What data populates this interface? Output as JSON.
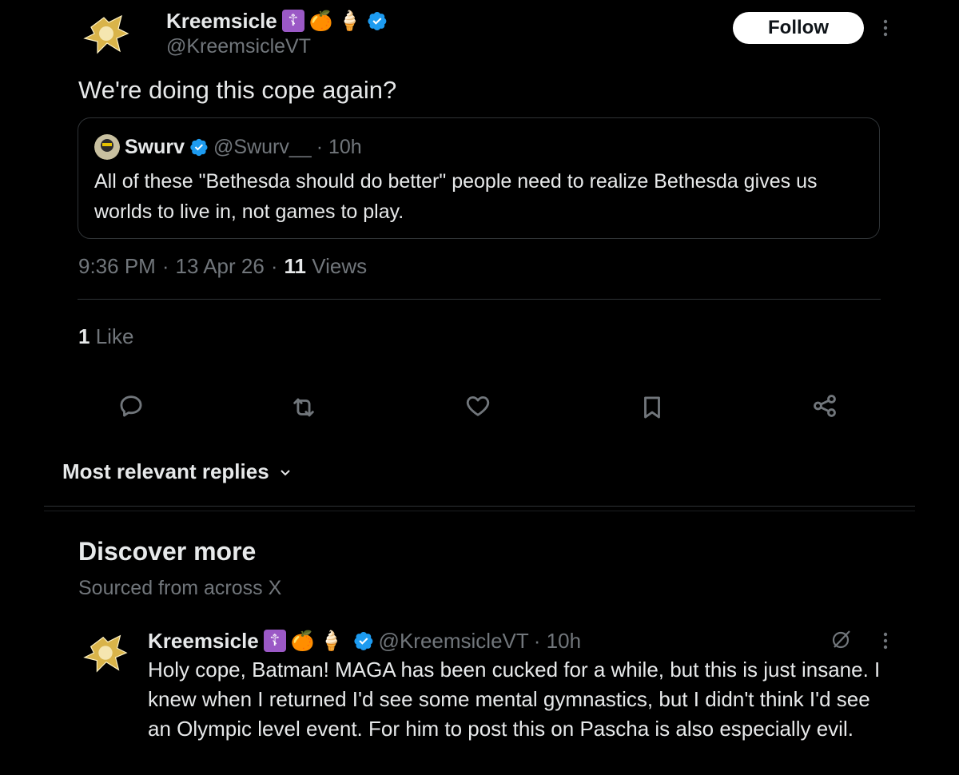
{
  "author": {
    "name": "Kreemsicle",
    "handle": "@KreemsicleVT",
    "emojis": [
      "☦",
      "🍊",
      "🍦"
    ]
  },
  "follow_label": "Follow",
  "post": {
    "text": "We're doing this cope again?"
  },
  "quote": {
    "name": "Swurv",
    "handle": "@Swurv__",
    "time": "· 10h",
    "text": "All of these \"Bethesda should do better\" people need to realize Bethesda gives us worlds to live in, not games to play."
  },
  "meta": {
    "time": "9:36 PM",
    "sep1": "·",
    "date": "13 Apr 26",
    "sep2": "·",
    "views_count": "11",
    "views_label": "Views"
  },
  "likes": {
    "count": "1",
    "label": "Like"
  },
  "actions": [
    "reply-icon",
    "retweet-icon",
    "like-icon",
    "bookmark-icon",
    "share-icon"
  ],
  "replies_sort": {
    "label": "Most relevant replies"
  },
  "discover": {
    "title": "Discover more",
    "subtitle": "Sourced from across X"
  },
  "discover_post": {
    "name": "Kreemsicle",
    "handle": "@KreemsicleVT",
    "time": "· 10h",
    "text": "Holy cope, Batman! MAGA has been cucked for a while, but this is just insane. I knew when I returned I'd see some mental gymnastics, but I didn't think I'd see an Olympic level event. For him to post this on Pascha is also especially evil."
  },
  "colors": {
    "background": "#000000",
    "text": "#e7e9ea",
    "muted": "#71767b",
    "verified": "#1d9bf0",
    "border": "#2f3336",
    "emoji_box": "#9b59c6"
  }
}
